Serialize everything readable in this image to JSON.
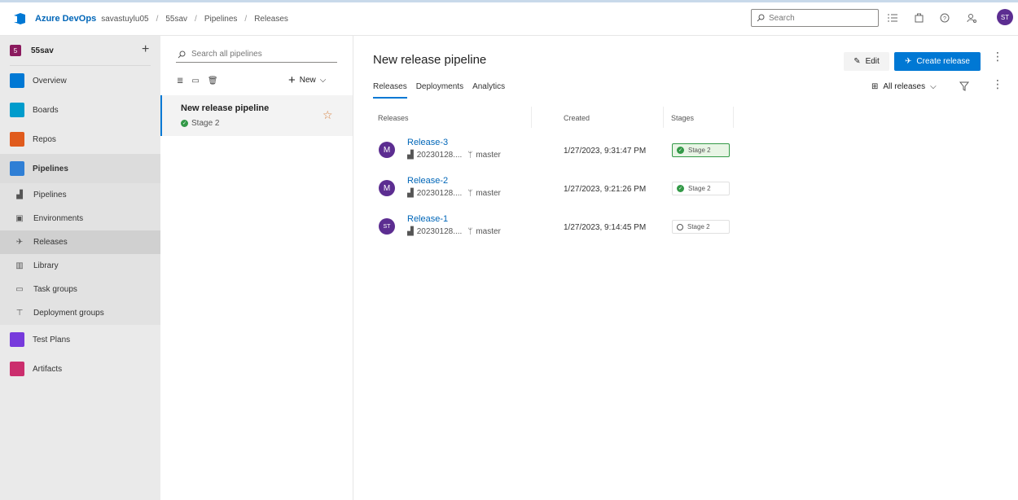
{
  "header": {
    "brand": "Azure DevOps",
    "org": "savastuylu05",
    "breadcrumb": [
      "55sav",
      "Pipelines",
      "Releases"
    ],
    "search_placeholder": "Search",
    "user_initials": "ST"
  },
  "nav": {
    "project_initial": "5",
    "project_name": "55sav",
    "items": [
      {
        "label": "Overview",
        "icon": "overview-icon",
        "color": "#0078d4"
      },
      {
        "label": "Boards",
        "icon": "boards-icon",
        "color": "#009ccc"
      },
      {
        "label": "Repos",
        "icon": "repos-icon",
        "color": "#e05b1d"
      },
      {
        "label": "Pipelines",
        "icon": "pipelines-icon",
        "color": "#2f7fd5"
      }
    ],
    "pipelines_sub": [
      {
        "label": "Pipelines",
        "icon": "pipelines-sub-icon"
      },
      {
        "label": "Environments",
        "icon": "environments-icon"
      },
      {
        "label": "Releases",
        "icon": "releases-icon"
      },
      {
        "label": "Library",
        "icon": "library-icon"
      },
      {
        "label": "Task groups",
        "icon": "task-groups-icon"
      },
      {
        "label": "Deployment groups",
        "icon": "deployment-groups-icon"
      }
    ],
    "bottom_items": [
      {
        "label": "Test Plans",
        "icon": "test-plans-icon",
        "color": "#773adc"
      },
      {
        "label": "Artifacts",
        "icon": "artifacts-icon",
        "color": "#cb2e6d"
      }
    ]
  },
  "pipelines_pane": {
    "search_placeholder": "Search all pipelines",
    "new_label": "New",
    "selected_pipeline": {
      "name": "New release pipeline",
      "stage": "Stage 2"
    }
  },
  "main": {
    "title": "New release pipeline",
    "edit_label": "Edit",
    "create_label": "Create release",
    "tabs": [
      "Releases",
      "Deployments",
      "Analytics"
    ],
    "filter_label": "All releases",
    "columns": [
      "Releases",
      "Created",
      "Stages"
    ],
    "releases": [
      {
        "avatar": "M",
        "name": "Release-3",
        "build": "20230128....",
        "branch": "master",
        "created": "1/27/2023, 9:31:47 PM",
        "stage": "Stage 2",
        "status": "succeeded",
        "highlighted": true
      },
      {
        "avatar": "M",
        "name": "Release-2",
        "build": "20230128....",
        "branch": "master",
        "created": "1/27/2023, 9:21:26 PM",
        "stage": "Stage 2",
        "status": "succeeded",
        "highlighted": false
      },
      {
        "avatar": "ST",
        "name": "Release-1",
        "build": "20230128....",
        "branch": "master",
        "created": "1/27/2023, 9:14:45 PM",
        "stage": "Stage 2",
        "status": "not-deployed",
        "highlighted": false
      }
    ]
  },
  "colors": {
    "accent": "#0078d4",
    "success": "#339947",
    "avatar": "#5c2d91"
  }
}
